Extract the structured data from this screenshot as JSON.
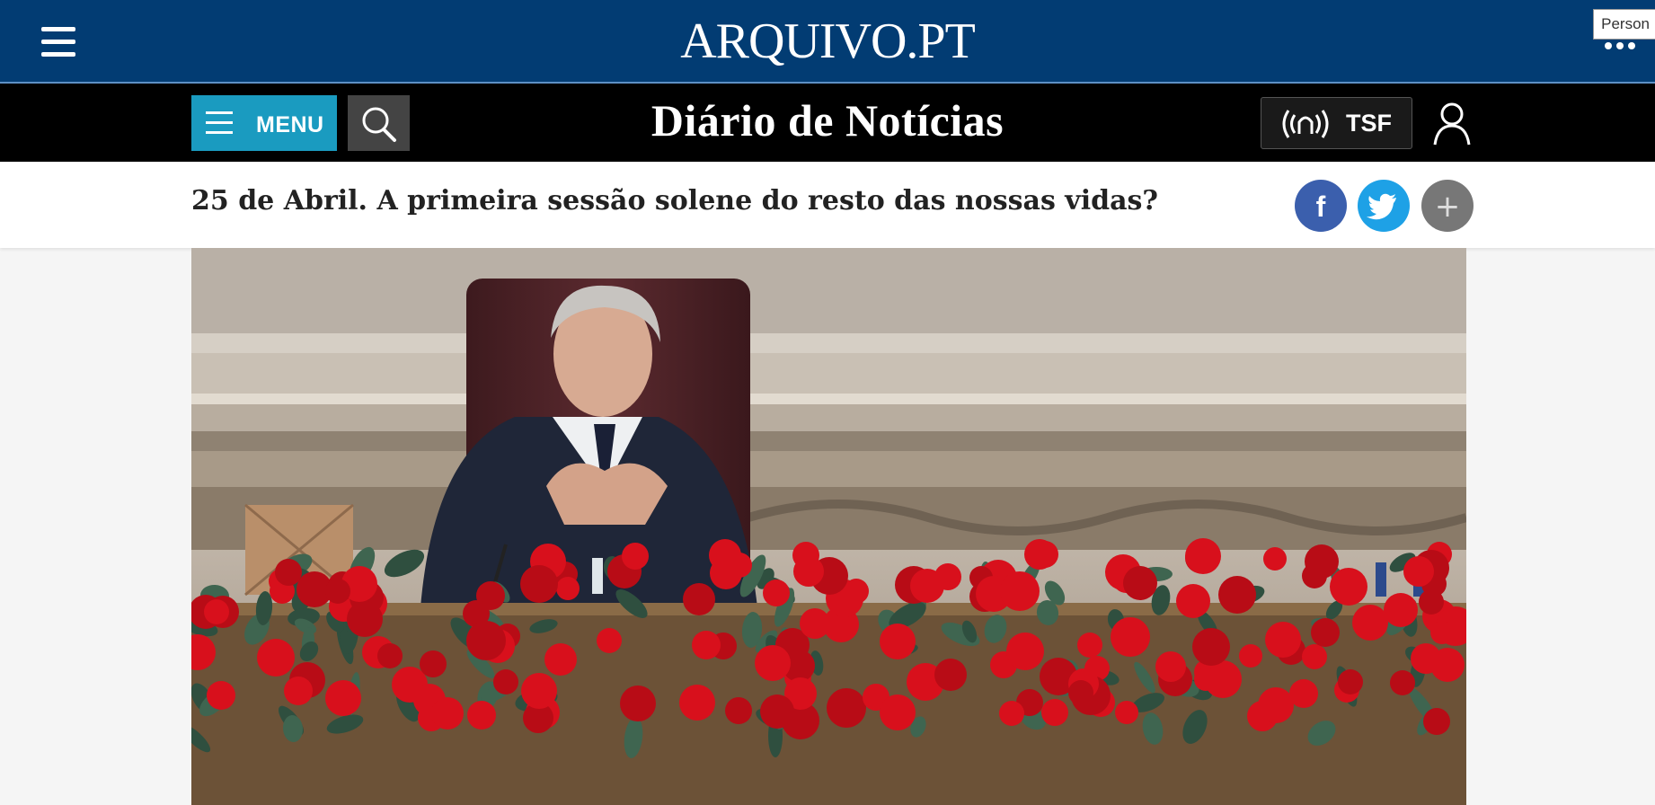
{
  "arquivo": {
    "logo": "ARQUIVO.PT",
    "tooltip": "Person",
    "menu_icon": "hamburger-icon",
    "options_icon": "more-dots-icon"
  },
  "dn": {
    "menu_label": "MENU",
    "logo": "Diário de Notícias",
    "radio_label": "TSF",
    "icons": [
      "hamburger-icon",
      "search-icon",
      "radio-signal-icon",
      "user-icon"
    ]
  },
  "article": {
    "headline": "25 de Abril. A primeira sessão solene do resto das nossas vidas?",
    "share": {
      "facebook_glyph": "f",
      "more_glyph": "+",
      "icons": [
        "facebook-icon",
        "twitter-icon",
        "plus-icon"
      ]
    }
  },
  "colors": {
    "arquivo_bar": "#023c73",
    "menu_button": "#1a9bc0",
    "facebook": "#3b5fad",
    "twitter": "#1ea1e6",
    "more": "#777777",
    "carnation_red": "#d8101c"
  }
}
